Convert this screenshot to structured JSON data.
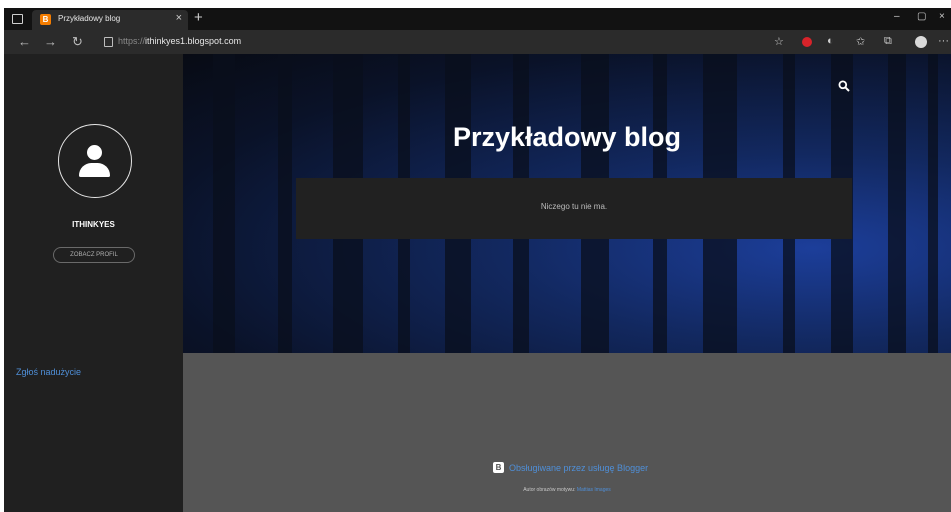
{
  "browser": {
    "tab": {
      "title": "Przykładowy blog",
      "favicon_letter": "B",
      "close": "×"
    },
    "new_tab": "+",
    "address": {
      "prefix": "https://",
      "host": "ithinkyes1.blogspot.com"
    },
    "window_controls": [
      "–",
      "▢",
      "×"
    ],
    "colors": {
      "favicon": "#f57d00",
      "abp": "#d8232a"
    }
  },
  "sidebar": {
    "username": "ITHINKYES",
    "profile_button": "ZOBACZ PROFIL",
    "report_link": "Zgłoś nadużycie"
  },
  "hero": {
    "title": "Przykładowy blog",
    "empty_message": "Niczego tu nie ma."
  },
  "footer": {
    "powered_by": "Obsługiwane przez usługę Blogger",
    "logo_letter": "B",
    "theme_credit_prefix": "Autor obrazów motywu:",
    "theme_credit_author": "Mattias Images"
  }
}
